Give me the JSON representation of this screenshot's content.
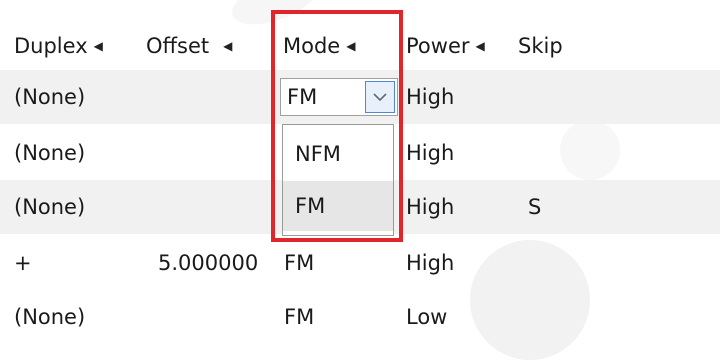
{
  "columns": [
    {
      "label": "Duplex",
      "sort_icon": "triangle-left-icon"
    },
    {
      "label": "Offset",
      "sort_icon": "triangle-left-icon"
    },
    {
      "label": "Mode",
      "sort_icon": "triangle-left-icon"
    },
    {
      "label": "Power",
      "sort_icon": "triangle-left-icon"
    },
    {
      "label": "Skip"
    }
  ],
  "rows": [
    {
      "duplex": "(None)",
      "offset": "",
      "mode": "FM",
      "power": "High",
      "skip": ""
    },
    {
      "duplex": "(None)",
      "offset": "",
      "mode": "NFM",
      "power": "High",
      "skip": ""
    },
    {
      "duplex": "(None)",
      "offset": "",
      "mode": "FM",
      "power": "High",
      "skip": "S"
    },
    {
      "duplex": "+",
      "offset": "5.000000",
      "mode": "FM",
      "power": "High",
      "skip": ""
    },
    {
      "duplex": "(None)",
      "offset": "",
      "mode": "FM",
      "power": "Low",
      "skip": ""
    }
  ],
  "mode_combo": {
    "value": "FM",
    "options": [
      "NFM",
      "FM"
    ],
    "button_icon": "chevron-down-icon"
  },
  "colors": {
    "highlight": "#e0262b",
    "combo_button_border": "#4c8ad1",
    "row_alt": "#f1f1f1"
  }
}
